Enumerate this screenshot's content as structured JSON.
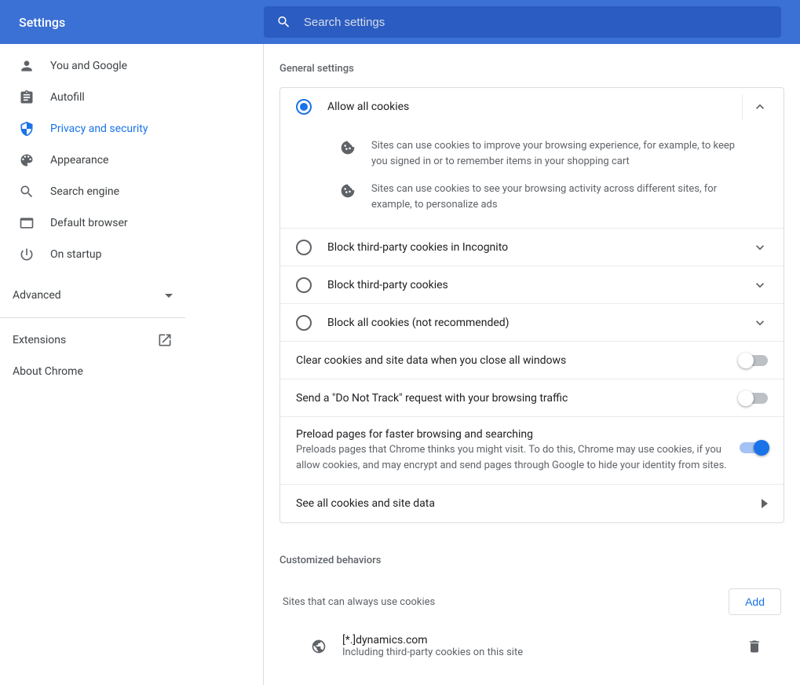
{
  "header": {
    "title": "Settings",
    "searchPlaceholder": "Search settings"
  },
  "sidebar": {
    "items": [
      {
        "label": "You and Google"
      },
      {
        "label": "Autofill"
      },
      {
        "label": "Privacy and security"
      },
      {
        "label": "Appearance"
      },
      {
        "label": "Search engine"
      },
      {
        "label": "Default browser"
      },
      {
        "label": "On startup"
      }
    ],
    "advanced": "Advanced",
    "extensions": "Extensions",
    "about": "About Chrome"
  },
  "general": {
    "title": "General settings",
    "options": [
      {
        "label": "Allow all cookies",
        "desc1": "Sites can use cookies to improve your browsing experience, for example, to keep you signed in or to remember items in your shopping cart",
        "desc2": "Sites can use cookies to see your browsing activity across different sites, for example, to personalize ads"
      },
      {
        "label": "Block third-party cookies in Incognito"
      },
      {
        "label": "Block third-party cookies"
      },
      {
        "label": "Block all cookies (not recommended)"
      }
    ],
    "toggles": [
      {
        "label": "Clear cookies and site data when you close all windows"
      },
      {
        "label": "Send a \"Do Not Track\" request with your browsing traffic"
      }
    ],
    "preload": {
      "title": "Preload pages for faster browsing and searching",
      "desc": "Preloads pages that Chrome thinks you might visit. To do this, Chrome may use cookies, if you allow cookies, and may encrypt and send pages through Google to hide your identity from sites."
    },
    "seeAll": "See all cookies and site data"
  },
  "custom": {
    "title": "Customized behaviors",
    "sitesAlways": "Sites that can always use cookies",
    "add": "Add",
    "site": {
      "domain": "[*.]dynamics.com",
      "note": "Including third-party cookies on this site"
    }
  }
}
